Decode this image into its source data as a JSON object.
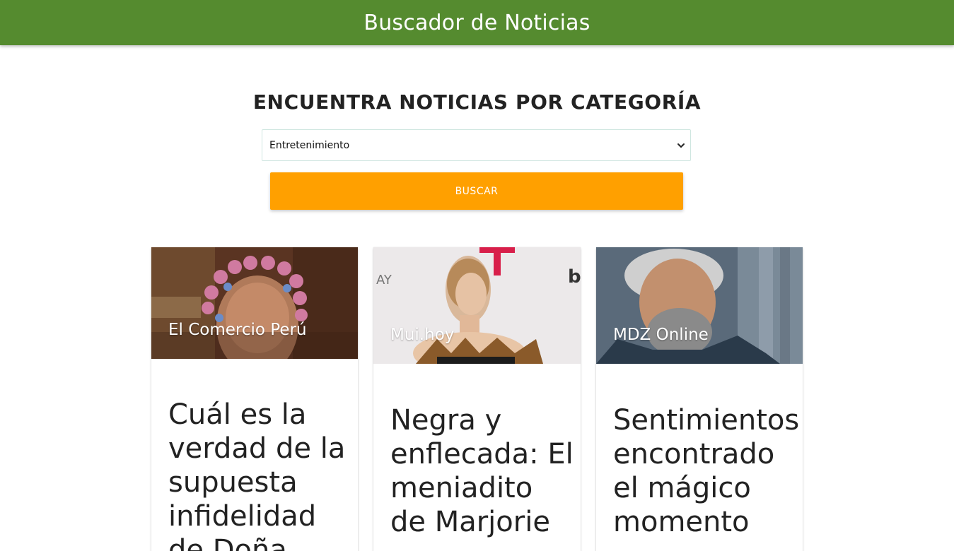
{
  "header": {
    "title": "Buscador de Noticias"
  },
  "search": {
    "heading": "ENCUENTRA NOTICIAS POR CATEGORÍA",
    "selected_category": "Entretenimiento",
    "button_label": "BUSCAR"
  },
  "colors": {
    "navbar": "#558b2f",
    "button": "#ffa000"
  },
  "cards": [
    {
      "source": "El Comercio Perú",
      "title": "Cuál es la verdad de la supuesta infidelidad de Doña"
    },
    {
      "source": "Mui.hoy",
      "title": "Negra y enflecada: El meniadito de Marjorie"
    },
    {
      "source": "MDZ Online",
      "title": "Sentimientos encontrado el mágico momento"
    }
  ]
}
